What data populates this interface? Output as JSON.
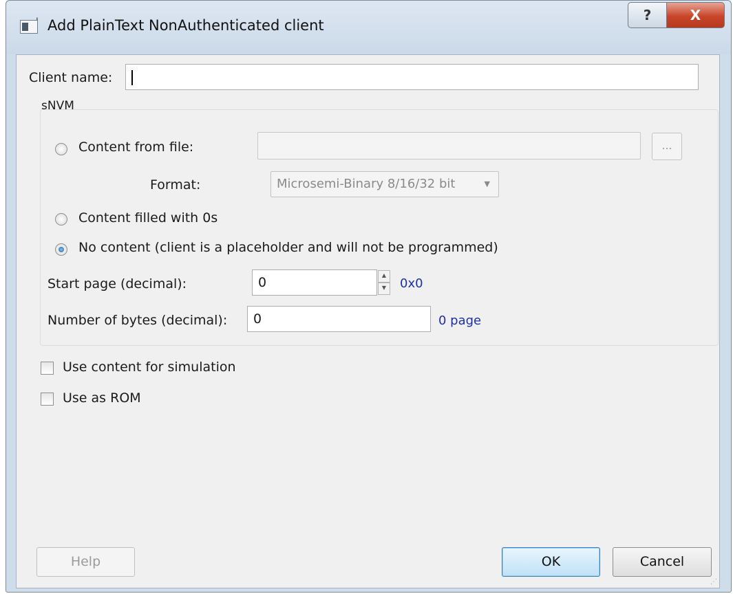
{
  "window": {
    "title": "Add PlainText NonAuthenticated client",
    "help_glyph": "?",
    "close_glyph": "X"
  },
  "form": {
    "client_name_label": "Client name:",
    "client_name_value": "",
    "group_title": "sNVM",
    "content_from_file_label": "Content from file:",
    "file_path_value": "",
    "browse_label": "...",
    "format_label": "Format:",
    "format_value": "Microsemi-Binary 8/16/32 bit",
    "content_zeros_label": "Content filled with 0s",
    "no_content_label": "No content (client is a placeholder and will not be programmed)",
    "selected_option": "no_content",
    "start_page_label": "Start page (decimal):",
    "start_page_value": "0",
    "start_page_hex": "0x0",
    "num_bytes_label": "Number of bytes (decimal):",
    "num_bytes_value": "0",
    "num_bytes_pages": "0 page",
    "use_simulation_label": "Use content for simulation",
    "use_simulation_checked": false,
    "use_rom_label": "Use as ROM",
    "use_rom_checked": false
  },
  "buttons": {
    "help": "Help",
    "ok": "OK",
    "cancel": "Cancel"
  },
  "icons": {
    "app": "dialog-app-icon",
    "spin_up": "▲",
    "spin_down": "▼",
    "combo_arrow": "▼",
    "grip": "⋰"
  }
}
